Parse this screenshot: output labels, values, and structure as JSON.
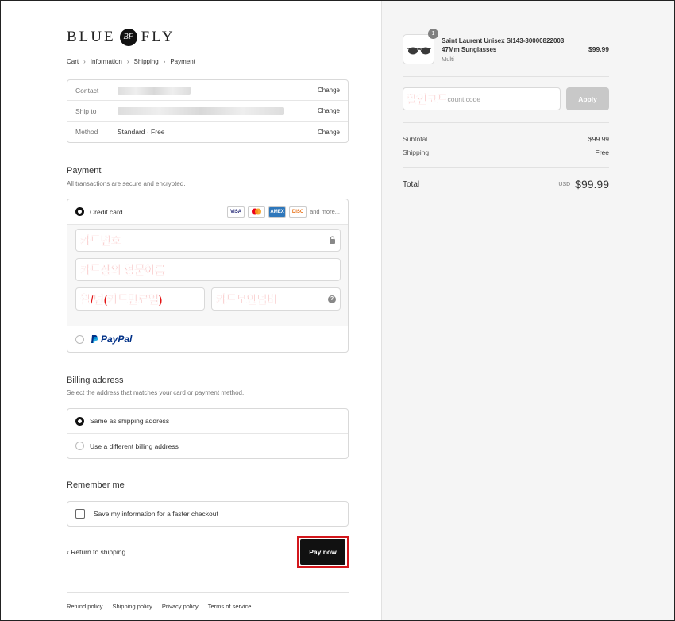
{
  "brand": {
    "left": "BLUE",
    "mono": "BF",
    "right": "FLY"
  },
  "breadcrumb": [
    "Cart",
    "Information",
    "Shipping",
    "Payment"
  ],
  "info": {
    "contact_label": "Contact",
    "shipto_label": "Ship to",
    "method_label": "Method",
    "method_value": "Standard · Free",
    "change": "Change"
  },
  "payment": {
    "title": "Payment",
    "subtitle": "All transactions are secure and encrypted.",
    "credit_card": "Credit card",
    "more_cards": "and more...",
    "card_brands": [
      "VISA",
      "MC",
      "AMEX",
      "DISC"
    ],
    "card_number": "카드번호",
    "name_on_card": "카드상의 영문이름",
    "expiry": "월/년(카드만료일)",
    "security_code": "카드보안넘버",
    "paypal": "PayPal"
  },
  "billing": {
    "title": "Billing address",
    "subtitle": "Select the address that matches your card or payment method.",
    "same": "Same as shipping address",
    "different": "Use a different billing address"
  },
  "remember": {
    "title": "Remember me",
    "save": "Save my information for a faster checkout"
  },
  "actions": {
    "return": "Return to shipping",
    "pay": "Pay now"
  },
  "footer": [
    "Refund policy",
    "Shipping policy",
    "Privacy policy",
    "Terms of service"
  ],
  "summary": {
    "qty": "1",
    "product_name": "Saint Laurent Unisex Sl143-30000822003 47Mm Sunglasses",
    "variant": "Multi",
    "price": "$99.99",
    "discount_label": "할인코드",
    "discount_placeholder": "count code",
    "apply": "Apply",
    "subtotal_label": "Subtotal",
    "subtotal": "$99.99",
    "shipping_label": "Shipping",
    "shipping": "Free",
    "total_label": "Total",
    "currency": "USD",
    "total": "$99.99"
  }
}
